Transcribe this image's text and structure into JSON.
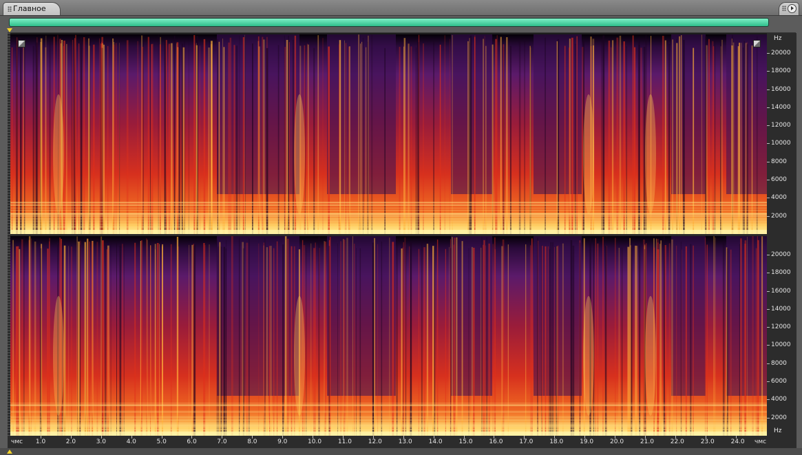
{
  "tabs": {
    "main_label": "Главное"
  },
  "frequency_axis": {
    "unit": "Hz",
    "ticks": [
      "20000",
      "18000",
      "16000",
      "14000",
      "12000",
      "10000",
      "8000",
      "6000",
      "4000",
      "2000"
    ]
  },
  "time_axis": {
    "unit_label": "чмс",
    "ticks": [
      "1.0",
      "2.0",
      "3.0",
      "4.0",
      "5.0",
      "6.0",
      "7.0",
      "8.0",
      "9.0",
      "10.0",
      "11.0",
      "12.0",
      "13.0",
      "14.0",
      "15.0",
      "16.0",
      "17.0",
      "18.0",
      "19.0",
      "20.0",
      "21.0",
      "22.0",
      "23.0",
      "24.0"
    ]
  },
  "colors": {
    "overview_bar": "#3fd6a0",
    "spectral_low": "#000000",
    "spectral_mid": "#6a1f78",
    "spectral_high": "#e0301a",
    "spectral_peak": "#ffe07a",
    "marker": "#f2d22a"
  },
  "icons": {
    "tab_grip": "grip-icon",
    "panel_menu": "panel-menu-icon",
    "play_marker": "playhead-marker-icon"
  }
}
